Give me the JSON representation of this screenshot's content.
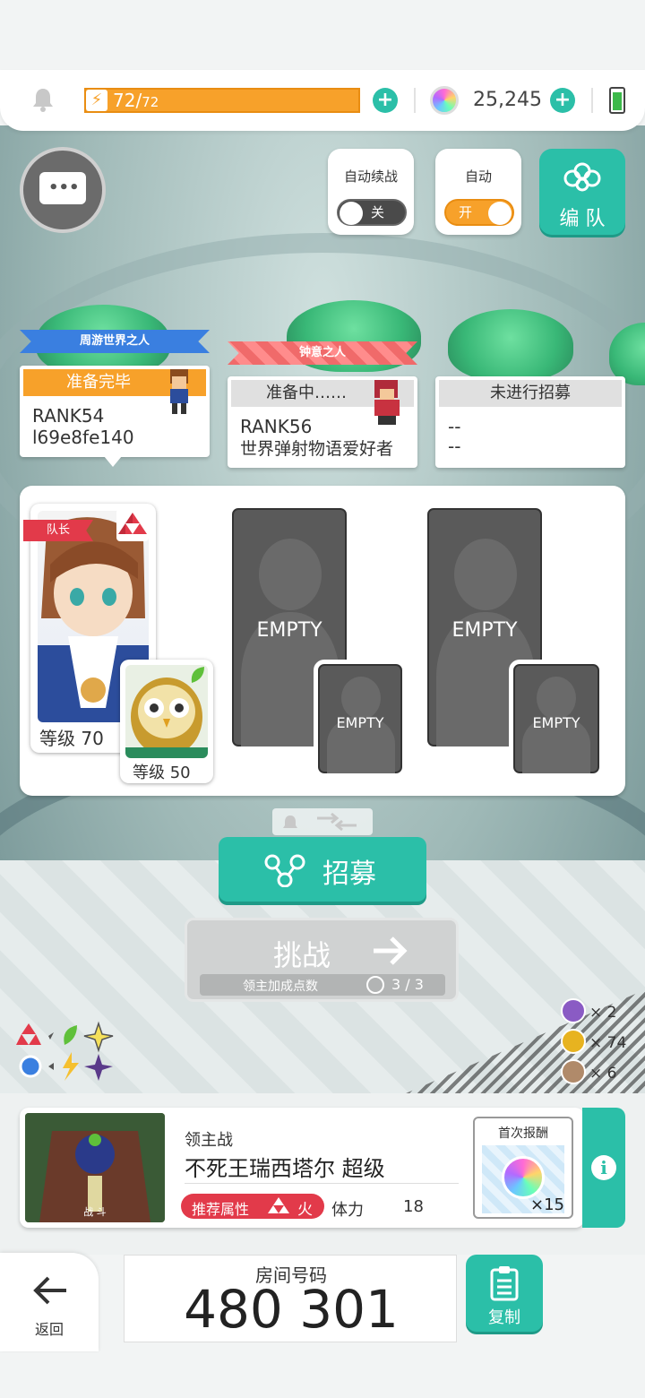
{
  "status_bar": {
    "stamina_current": "72",
    "stamina_sep": "/",
    "stamina_max": "72",
    "stamina_fraction": 1.0,
    "gems": "25,245"
  },
  "controls": {
    "auto_continue_label": "自动续战",
    "auto_continue_state": "关",
    "auto_label": "自动",
    "auto_state": "开",
    "team_edit_label": "编 队"
  },
  "players": [
    {
      "title": "周游世界之人",
      "status": "准备完毕",
      "rank": "RANK54",
      "name": "l69e8fe140"
    },
    {
      "title": "钟意之人",
      "status": "准备中……",
      "rank": "RANK56",
      "name": "世界弹射物语爱好者"
    },
    {
      "title": "",
      "status": "未进行招募",
      "rank": "--",
      "name": "--"
    }
  ],
  "party": {
    "leader_badge": "队长",
    "main_level": "等级 70",
    "sub_level": "等级 50",
    "empty_label": "EMPTY"
  },
  "recruit_label": "招募",
  "challenge": {
    "label": "挑战",
    "points_label": "领主加成点数",
    "points_value": "3 / 3"
  },
  "rewards": [
    {
      "icon": "purple-medal-icon",
      "count": "× 2",
      "color": "#8a5bc4"
    },
    {
      "icon": "gold-medal-icon",
      "count": "× 74",
      "color": "#e7b320"
    },
    {
      "icon": "bronze-medal-icon",
      "count": "× 6",
      "color": "#b08a6a"
    }
  ],
  "boss": {
    "kind": "领主战",
    "name": "不死王瑞西塔尔 超级",
    "battle_tag": "战 斗",
    "recommend_label": "推荐属性",
    "element": "火",
    "stamina_label": "体力",
    "stamina_cost": "18",
    "first_reward_label": "首次报酬",
    "first_reward_count": "×15"
  },
  "footer": {
    "back_label": "返回",
    "room_label": "房间号码",
    "room_number": "480 301",
    "copy_label": "复制"
  },
  "colors": {
    "accent": "#2bbfa8",
    "stamina": "#f7a12a",
    "fire": "#e23a4a"
  }
}
